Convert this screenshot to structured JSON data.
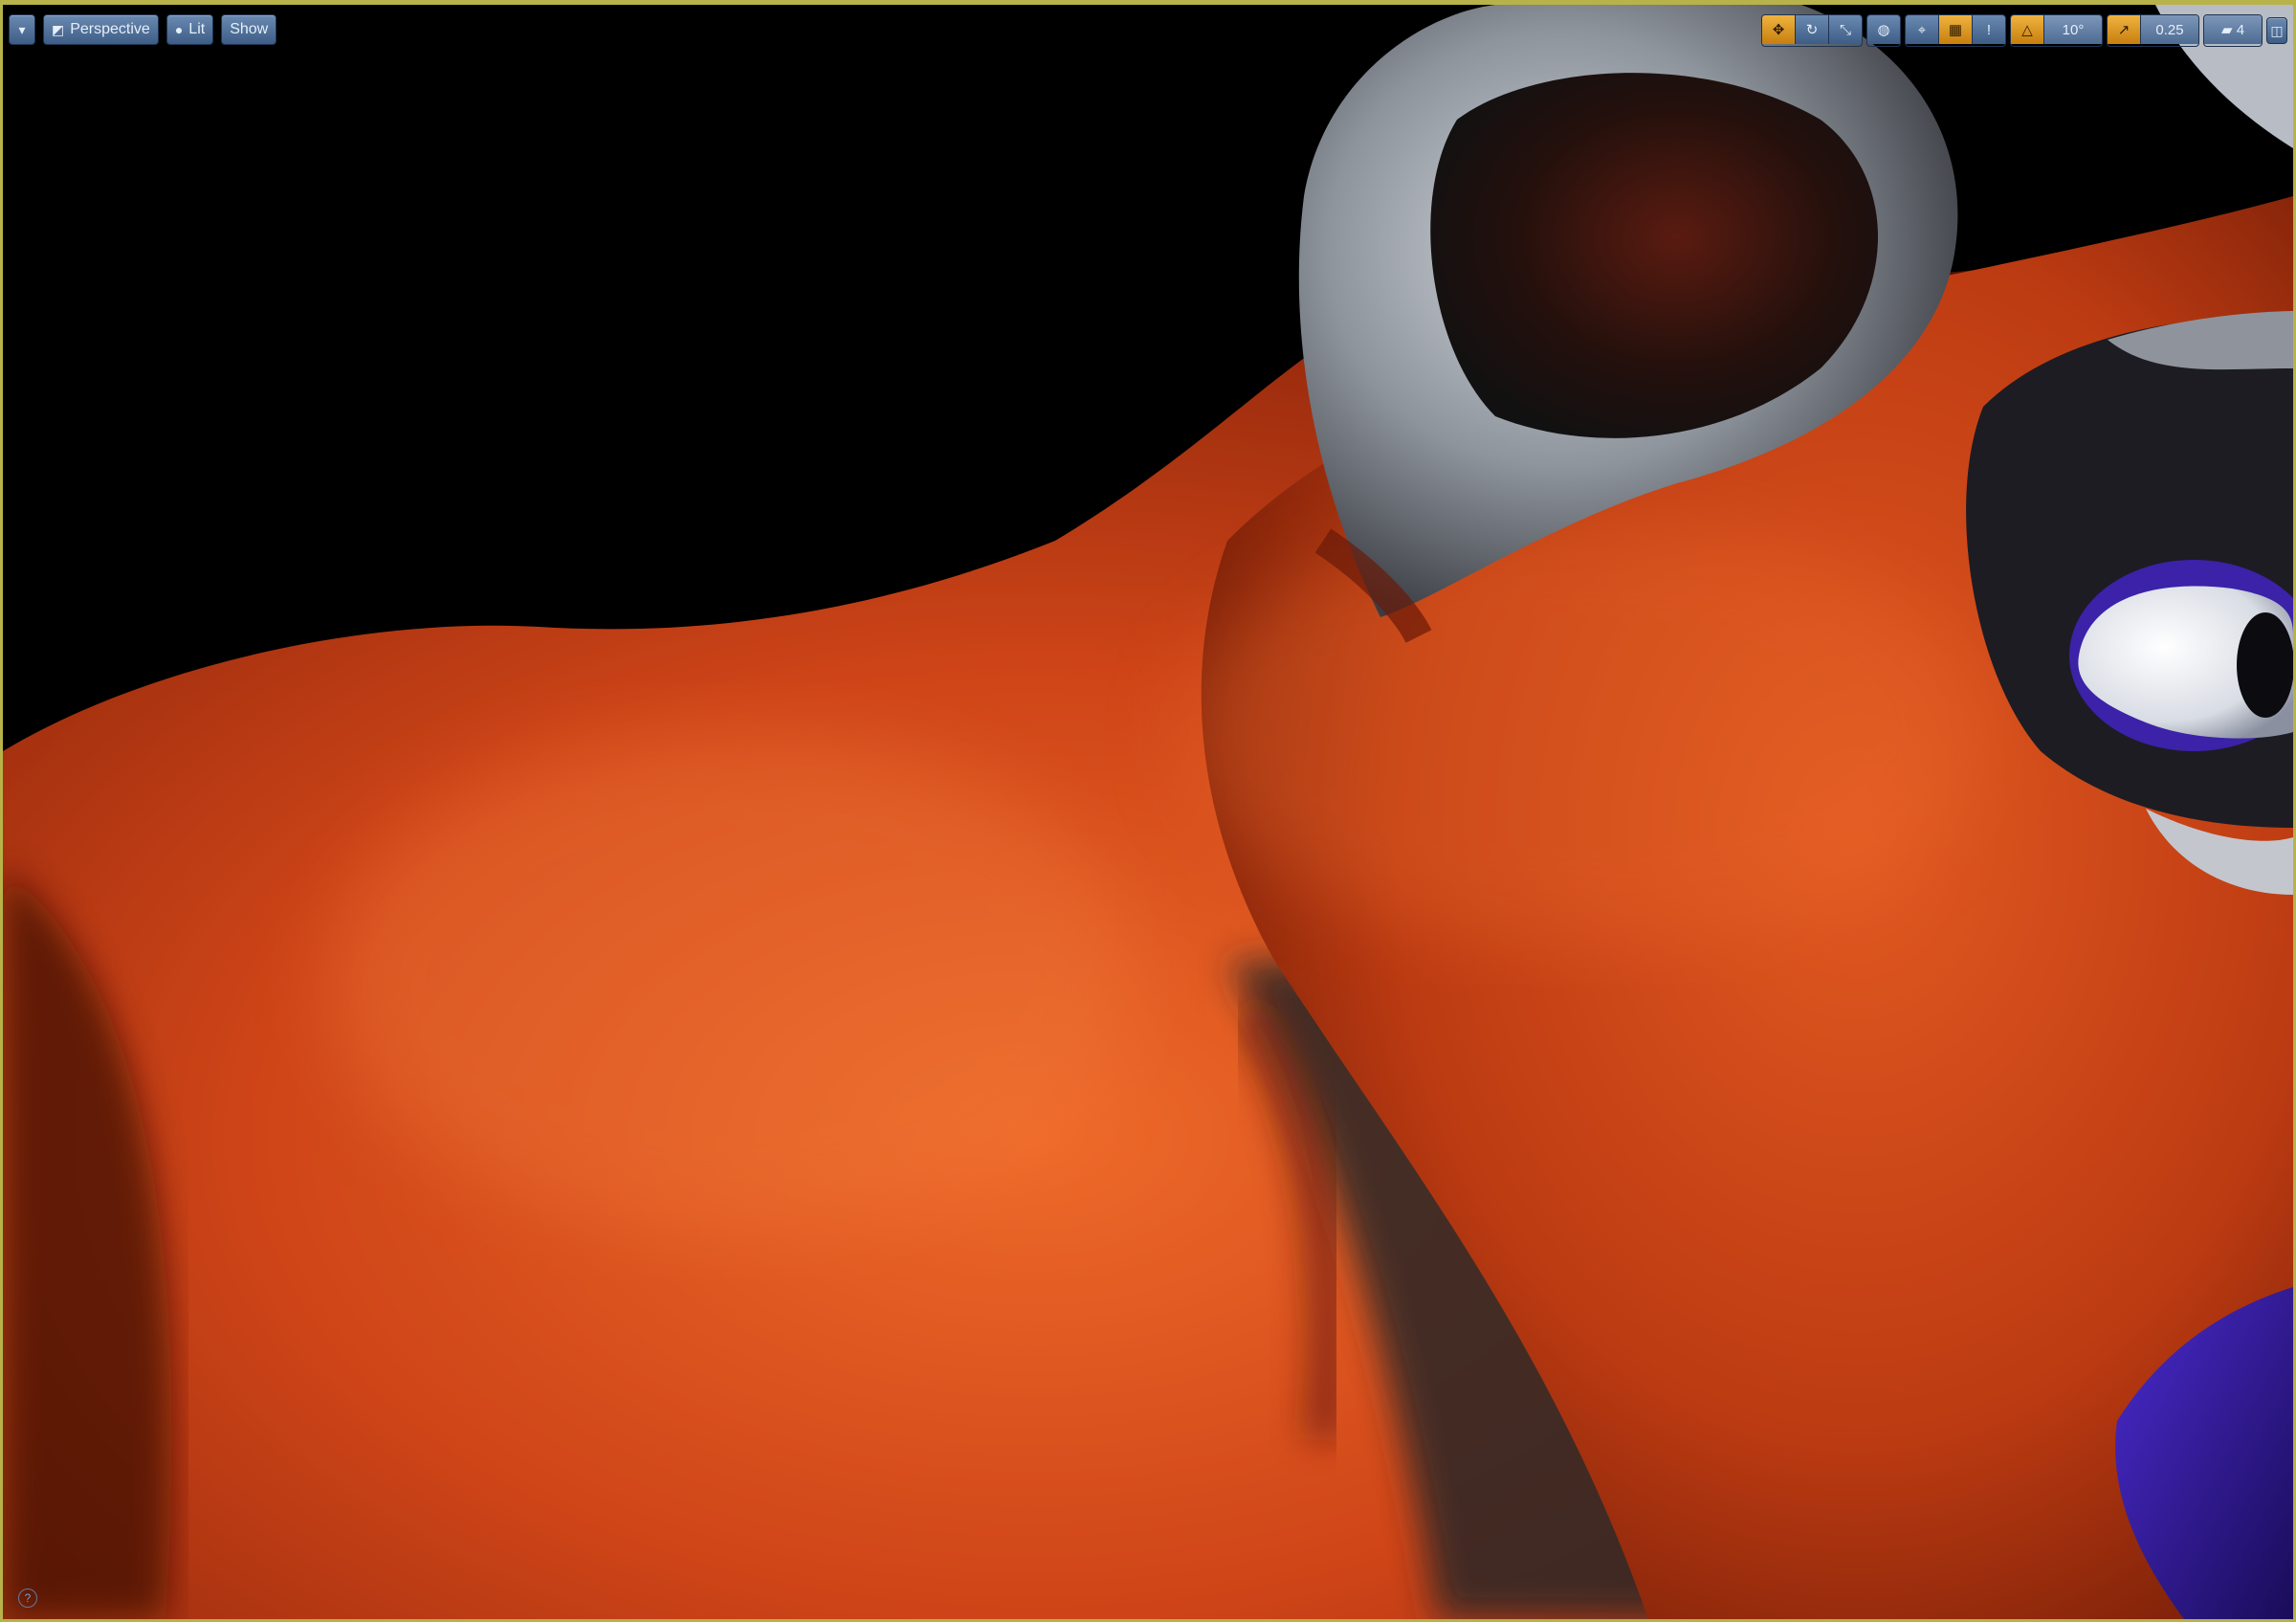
{
  "viewport": {
    "perspective_label": "Perspective",
    "lit_label": "Lit",
    "show_label": "Show",
    "rotation_snap_value": "10°",
    "scale_snap_value": "0.25",
    "camera_speed_value": "4",
    "colors": {
      "frame_border": "#b8b24a",
      "toolbar_button": "#4d6d96",
      "active_toggle": "#e0a030",
      "fur_orange": "#d2481b",
      "fur_gray": "#9aa0a8",
      "eye_purple": "#3a21a0"
    },
    "icons": {
      "menu": "chevron-down-icon",
      "perspective": "cube-icon",
      "lit": "sphere-icon",
      "translate": "move-icon",
      "rotate": "rotate-icon",
      "scale": "scale-icon",
      "world_local": "globe-icon",
      "surface_snap": "surface-snap-icon",
      "grid_snap": "grid-icon",
      "warning": "exclamation-icon",
      "rotation_snap": "angle-icon",
      "scale_snap": "scale-snap-icon",
      "camera_speed": "camera-icon",
      "maximize": "maximize-icon",
      "help": "help-icon"
    }
  }
}
